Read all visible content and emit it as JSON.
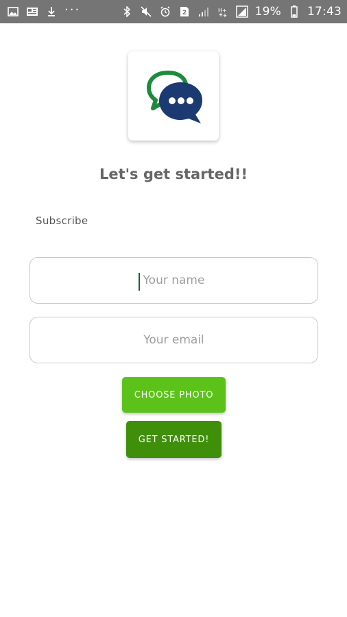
{
  "status_bar": {
    "battery": "19%",
    "time": "17:43",
    "sim_badge": "2",
    "network_label": "H+",
    "left_icons": [
      "gallery-icon",
      "photo-icon",
      "download-icon",
      "more-dots-icon"
    ],
    "right_icons": [
      "bluetooth-icon",
      "mute-icon",
      "alarm-icon",
      "sim-2-icon",
      "signal-icon",
      "data-icon",
      "signal-icon-2",
      "battery-icon"
    ],
    "more_label": "···"
  },
  "app_icon": {
    "name": "chat-bubbles-icon",
    "colors": {
      "outline_bubble": "#1e8a3c",
      "filled_bubble": "#1c3a72"
    }
  },
  "title": "Let's get started!!",
  "subscribe_label": "Subscribe",
  "form": {
    "name_placeholder": "Your name",
    "email_placeholder": "Your email"
  },
  "buttons": {
    "choose_photo": "CHOOSE PHOTO",
    "get_started": "GET STARTED!"
  },
  "colors": {
    "status_bar": "#757575",
    "choose_photo_bg": "#5cc21a",
    "get_started_bg": "#3f8f0a",
    "field_border": "#c8c8c8",
    "title_text": "#666666"
  }
}
